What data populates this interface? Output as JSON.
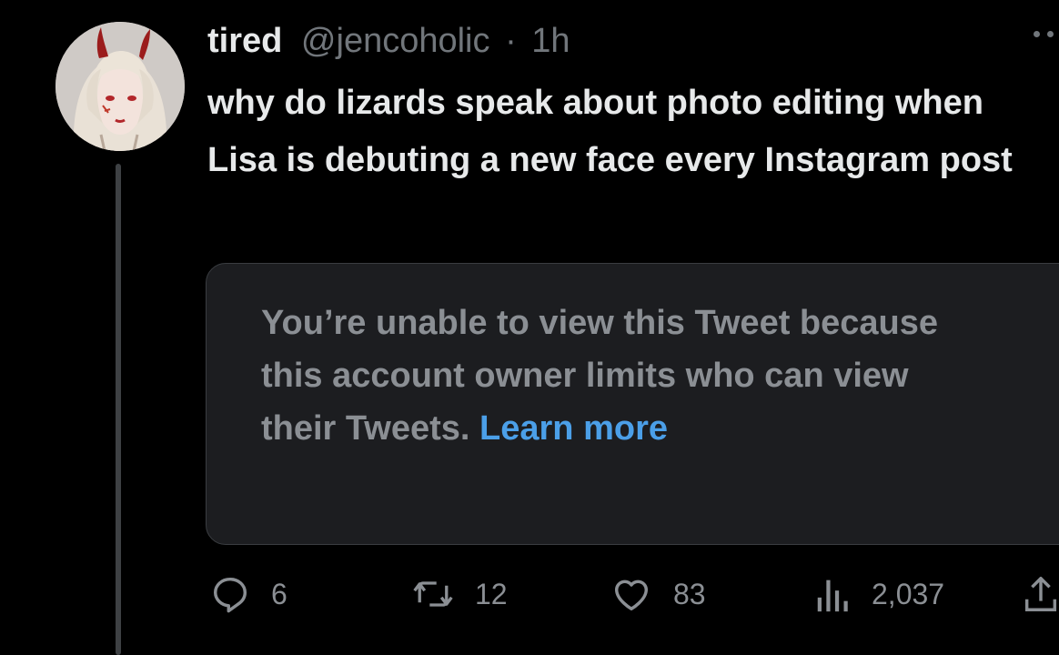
{
  "tweet": {
    "display_name": "tired",
    "handle": "@jencoholic",
    "separator": "·",
    "time": "1h",
    "text": "why do lizards speak about photo editing when Lisa is debuting a new face every Instagram post",
    "avatar_icon": "anime-girl-avatar",
    "more_icon": "more-dots-icon"
  },
  "quoted_notice": {
    "message": "You’re unable to view this Tweet because this account owner limits who can view their Tweets. ",
    "link_label": "Learn more"
  },
  "actions": {
    "reply_count": "6",
    "retweet_count": "12",
    "like_count": "83",
    "view_count": "2,037"
  },
  "colors": {
    "background": "#000000",
    "primary_text": "#e7e9ea",
    "secondary_text": "#71767b",
    "link": "#4b9fe8",
    "card_background": "#1c1d20"
  }
}
